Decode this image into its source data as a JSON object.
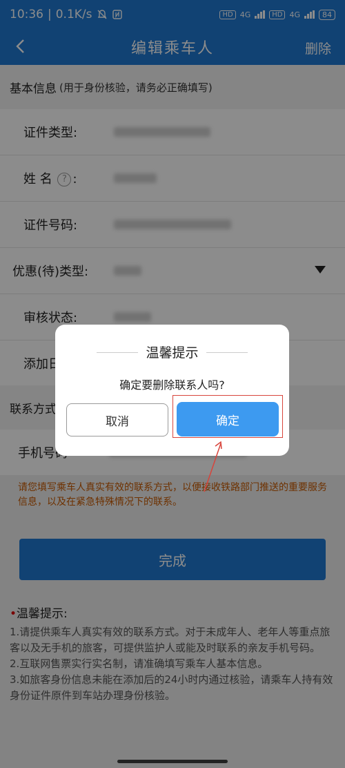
{
  "status_bar": {
    "time": "10:36",
    "network_speed": "0.1K/s",
    "signal1": "4G",
    "signal2": "4G",
    "battery": "84",
    "hd1": "HD",
    "hd2": "HD"
  },
  "header": {
    "title": "编辑乘车人",
    "delete_label": "删除"
  },
  "basic_info": {
    "heading": "基本信息",
    "note": "(用于身份核验，请务必正确填写)",
    "fields": [
      {
        "label": "证件类型:"
      },
      {
        "label_prefix": "姓 名",
        "label_suffix": ":"
      },
      {
        "label": "证件号码:"
      },
      {
        "label": "优惠(待)类型:"
      },
      {
        "label": "审核状态:"
      },
      {
        "label": "添加日"
      }
    ]
  },
  "contact": {
    "heading": "联系方式",
    "phone_label": "手机号码"
  },
  "notice_red": "请您填写乘车人真实有效的联系方式，以便接收铁路部门推送的重要服务信息，以及在紧急特殊情况下的联系。",
  "done_label": "完成",
  "tips": {
    "star": "•",
    "title": "温馨提示:",
    "items": [
      "1.请提供乘车人真实有效的联系方式。对于未成年人、老年人等重点旅客以及无手机的旅客，可提供监护人或能及时联系的亲友手机号码。",
      "2.互联网售票实行实名制，请准确填写乘车人基本信息。",
      "3.如旅客身份信息未能在添加后的24小时内通过核验，请乘车人持有效身份证件原件到车站办理身份核验。"
    ]
  },
  "dialog": {
    "title": "温馨提示",
    "message": "确定要删除联系人吗?",
    "cancel_label": "取消",
    "confirm_label": "确定"
  },
  "colors": {
    "brand": "#1f78d1",
    "confirm": "#3d9af0",
    "notice": "#c85a00",
    "highlight": "#d8443b"
  }
}
